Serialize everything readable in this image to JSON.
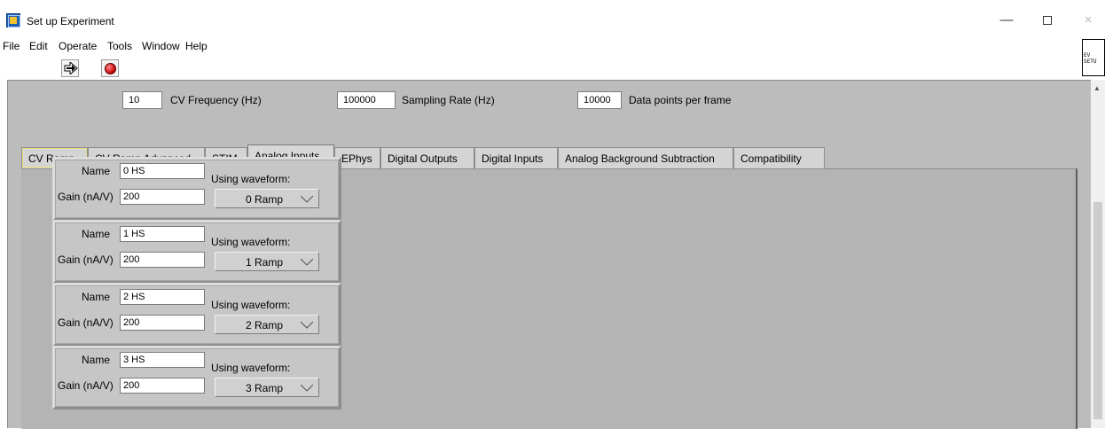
{
  "window": {
    "title": "Set up Experiment",
    "controls": {
      "minimize": "—",
      "maximize": "",
      "close": "×"
    }
  },
  "menu": [
    "File",
    "Edit",
    "Operate",
    "Tools",
    "Window",
    "Help"
  ],
  "toolbar": {
    "run_icon": "run-arrow-icon",
    "stop_icon": "abort-stop-icon"
  },
  "vi_icon_text": [
    "EV",
    "SETU"
  ],
  "settings": {
    "cv_frequency": {
      "value": "10",
      "label": "CV Frequency (Hz)"
    },
    "sampling_rate": {
      "value": "100000",
      "label": "Sampling Rate (Hz)"
    },
    "data_points": {
      "value": "10000",
      "label": "Data points per frame"
    }
  },
  "tabs": [
    "CV Ramp",
    "CV Ramp Advanced",
    "STIM",
    "Analog Inputs",
    "EPhys",
    "Digital Outputs",
    "Digital Inputs",
    "Analog Background Subtraction",
    "Compatibility"
  ],
  "active_tab": "Analog Inputs",
  "channel_labels": {
    "name": "Name",
    "gain": "Gain (nA/V)",
    "using_waveform": "Using waveform:"
  },
  "channels": [
    {
      "name": "0 HS",
      "gain": "200",
      "waveform": "0 Ramp"
    },
    {
      "name": "1 HS",
      "gain": "200",
      "waveform": "1 Ramp"
    },
    {
      "name": "2 HS",
      "gain": "200",
      "waveform": "2 Ramp"
    },
    {
      "name": "3 HS",
      "gain": "200",
      "waveform": "3 Ramp"
    }
  ],
  "colors": {
    "panel_bg": "#bcbcbc",
    "tab_content_bg": "#b4b4b4",
    "stop_button": "#d01010"
  }
}
